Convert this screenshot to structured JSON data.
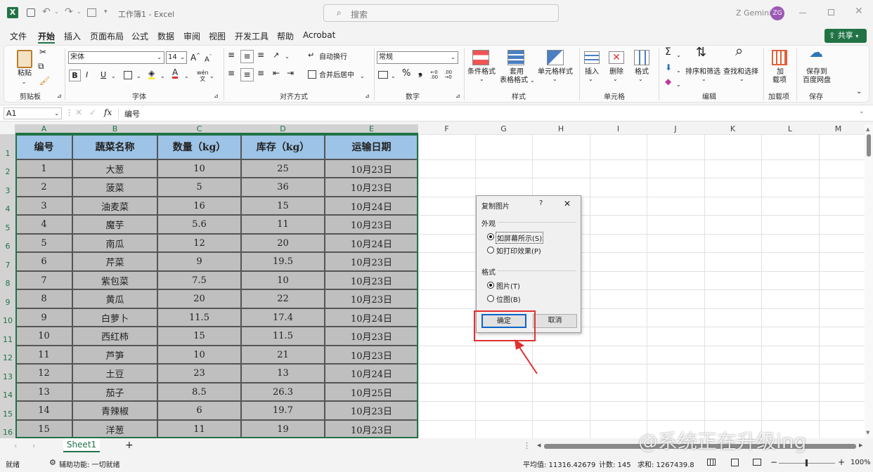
{
  "app": {
    "window_title": "工作簿1 - Excel",
    "search_placeholder": "搜索",
    "user_name": "Z Gemini",
    "user_initials": "ZG"
  },
  "menu": {
    "items": [
      "文件",
      "开始",
      "插入",
      "页面布局",
      "公式",
      "数据",
      "审阅",
      "视图",
      "开发工具",
      "帮助",
      "Acrobat"
    ],
    "active": "开始",
    "share_label": "共享"
  },
  "ribbon": {
    "paste_label": "粘贴",
    "font_name": "宋体",
    "font_size": "14",
    "wrap_text": "自动换行",
    "merge_center": "合并后居中",
    "number_format": "常规",
    "conditional_format": "条件格式",
    "format_as_table_1": "套用",
    "format_as_table_2": "表格格式",
    "cell_styles": "单元格样式",
    "insert": "插入",
    "delete": "删除",
    "format": "格式",
    "sort_filter": "排序和筛选",
    "find_select": "查找和选择",
    "addins_1": "加",
    "addins_2": "载项",
    "save_to_1": "保存到",
    "save_to_2": "百度网盘",
    "groups": [
      "剪贴板",
      "字体",
      "对齐方式",
      "数字",
      "样式",
      "单元格",
      "编辑",
      "加载项",
      "保存"
    ]
  },
  "formula_bar": {
    "name_box": "A1",
    "content": "编号",
    "fx": "fx"
  },
  "columns": [
    "A",
    "B",
    "C",
    "D",
    "E",
    "F",
    "G",
    "H",
    "I",
    "J",
    "K",
    "L",
    "M"
  ],
  "rows": [
    "1",
    "2",
    "3",
    "4",
    "5",
    "6",
    "7",
    "8",
    "9",
    "10",
    "11",
    "12",
    "13",
    "14",
    "15",
    "16"
  ],
  "table": {
    "headers": [
      "编号",
      "蔬菜名称",
      "数量（kg）",
      "库存（kg）",
      "运输日期"
    ],
    "rows": [
      [
        "1",
        "大葱",
        "10",
        "25",
        "10月23日"
      ],
      [
        "2",
        "菠菜",
        "5",
        "36",
        "10月23日"
      ],
      [
        "3",
        "油麦菜",
        "16",
        "15",
        "10月24日"
      ],
      [
        "4",
        "魔芋",
        "5.6",
        "11",
        "10月23日"
      ],
      [
        "5",
        "南瓜",
        "12",
        "20",
        "10月24日"
      ],
      [
        "6",
        "芹菜",
        "9",
        "19.5",
        "10月23日"
      ],
      [
        "7",
        "紫包菜",
        "7.5",
        "10",
        "10月23日"
      ],
      [
        "8",
        "黄瓜",
        "20",
        "22",
        "10月23日"
      ],
      [
        "9",
        "白萝卜",
        "11.5",
        "17.4",
        "10月24日"
      ],
      [
        "10",
        "西红柿",
        "15",
        "11.5",
        "10月23日"
      ],
      [
        "11",
        "芦笋",
        "10",
        "21",
        "10月23日"
      ],
      [
        "12",
        "土豆",
        "23",
        "13",
        "10月24日"
      ],
      [
        "13",
        "茄子",
        "8.5",
        "26.3",
        "10月25日"
      ],
      [
        "14",
        "青辣椒",
        "6",
        "19.7",
        "10月23日"
      ],
      [
        "15",
        "洋葱",
        "11",
        "19",
        "10月23日"
      ]
    ]
  },
  "dialog": {
    "title": "复制图片",
    "help": "?",
    "appearance_label": "外观",
    "opt_as_screen": "如屏幕所示(S)",
    "opt_as_print": "如打印效果(P)",
    "format_label": "格式",
    "opt_picture": "图片(T)",
    "opt_bitmap": "位图(B)",
    "ok": "确定",
    "cancel": "取消"
  },
  "sheet": {
    "tab": "Sheet1",
    "add": "+"
  },
  "status": {
    "ready": "就绪",
    "accessibility": "辅助功能: 一切就绪",
    "average": "平均值: 11316.42679",
    "count": "计数: 145",
    "sum": "求和: 1267439.8",
    "zoom": "100%"
  },
  "watermark": "@系统正在升级ing",
  "colors": {
    "header_fill": "#9dc3e6",
    "data_fill": "#bfbfbf",
    "excel_green": "#217346",
    "highlight": "#e03030"
  }
}
